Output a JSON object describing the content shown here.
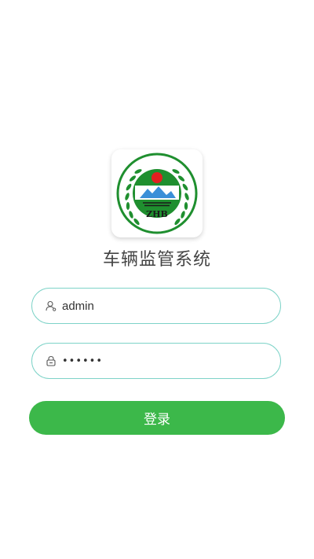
{
  "app": {
    "title": "车辆监管系统",
    "logo": {
      "icon": "environmental-protection-emblem",
      "text": "ZHB",
      "colors": {
        "green": "#1f8f2f",
        "red": "#e32020",
        "blue": "#3a8fd8"
      }
    }
  },
  "form": {
    "username": {
      "icon": "user-icon",
      "value": "admin"
    },
    "password": {
      "icon": "lock-icon",
      "value": "123456"
    },
    "submit_label": "登录"
  },
  "colors": {
    "primary": "#3cb84a",
    "input_border": "#7ed3c8",
    "title_text": "#444444"
  }
}
